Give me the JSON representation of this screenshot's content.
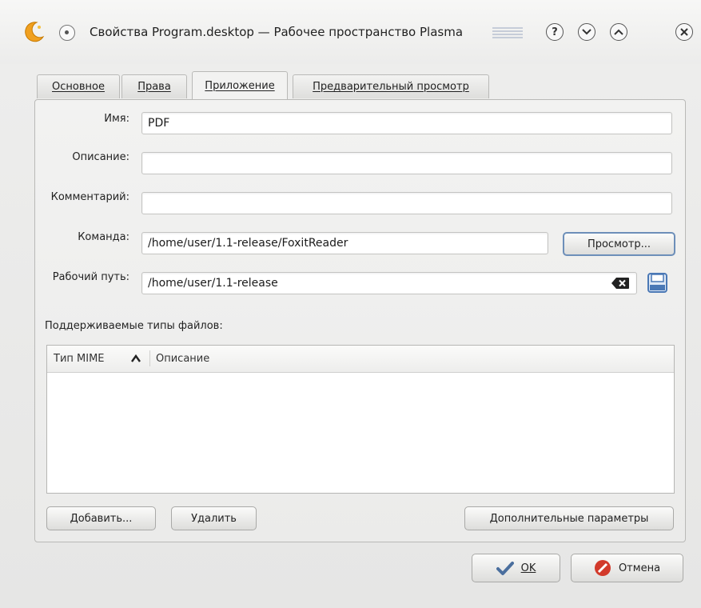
{
  "window": {
    "title": "Свойства Program.desktop — Рабочее пространство Plasma",
    "help_glyph": "?",
    "minimize_glyph": "⌄",
    "maximize_glyph": "⌃",
    "close_glyph": "✕"
  },
  "tabs": [
    {
      "label": "Основное",
      "active": false
    },
    {
      "label": "Права",
      "active": false
    },
    {
      "label": "Приложение",
      "active": true
    },
    {
      "label": "Предварительный просмотр",
      "active": false
    }
  ],
  "form": {
    "name_label": "Имя:",
    "name_value": "PDF",
    "description_label": "Описание:",
    "description_value": "",
    "comment_label": "Комментарий:",
    "comment_value": "",
    "command_label": "Команда:",
    "command_value": "/home/user/1.1-release/FoxitReader",
    "browse_label": "Просмотр...",
    "workdir_label": "Рабочий путь:",
    "workdir_value": "/home/user/1.1-release"
  },
  "filetypes": {
    "section_label": "Поддерживаемые типы файлов:",
    "columns": [
      "Тип MIME",
      "Описание"
    ],
    "sort_column": "Тип MIME",
    "sort_direction": "ascending",
    "rows": []
  },
  "list_buttons": {
    "add": "Добавить...",
    "remove": "Удалить",
    "advanced": "Дополнительные параметры"
  },
  "dialog_buttons": {
    "ok": "OK",
    "cancel": "Отмена"
  },
  "icons": {
    "app": "kde-window-icon",
    "clear": "clear-text-icon",
    "save": "floppy-save-icon",
    "ok": "checkmark-icon",
    "cancel": "cancel-circle-icon"
  },
  "colors": {
    "focus_border": "#6d8fb9",
    "cancel_red": "#d23a2b",
    "save_blue": "#4a78b5"
  }
}
